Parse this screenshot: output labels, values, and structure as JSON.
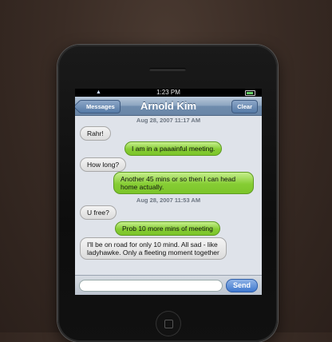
{
  "status_bar": {
    "time": "1:23 PM"
  },
  "nav": {
    "back_label": "Messages",
    "title": "Arnold Kim",
    "clear_label": "Clear"
  },
  "thread": {
    "stamp_1": "Aug 28, 2007 11:17 AM",
    "stamp_2": "Aug 28, 2007 11:53 AM",
    "messages": [
      {
        "dir": "in",
        "text": "Rahr!"
      },
      {
        "dir": "out",
        "text": "I am in a paaainful meeting."
      },
      {
        "dir": "in",
        "text": "How long?"
      },
      {
        "dir": "out",
        "text": "Another 45 mins or so then I can head home actually."
      },
      {
        "dir": "in",
        "text": "U free?"
      },
      {
        "dir": "out",
        "text": "Prob 10 more mins of meeting"
      },
      {
        "dir": "in",
        "text": "I'll be on road for only 10 mind. All sad - like ladyhawke. Only a fleeting moment together"
      }
    ]
  },
  "composer": {
    "send_label": "Send",
    "input_value": ""
  },
  "colors": {
    "incoming": "#e8e8e8",
    "outgoing": "#86cd34",
    "nav_accent": "#6985a6"
  }
}
